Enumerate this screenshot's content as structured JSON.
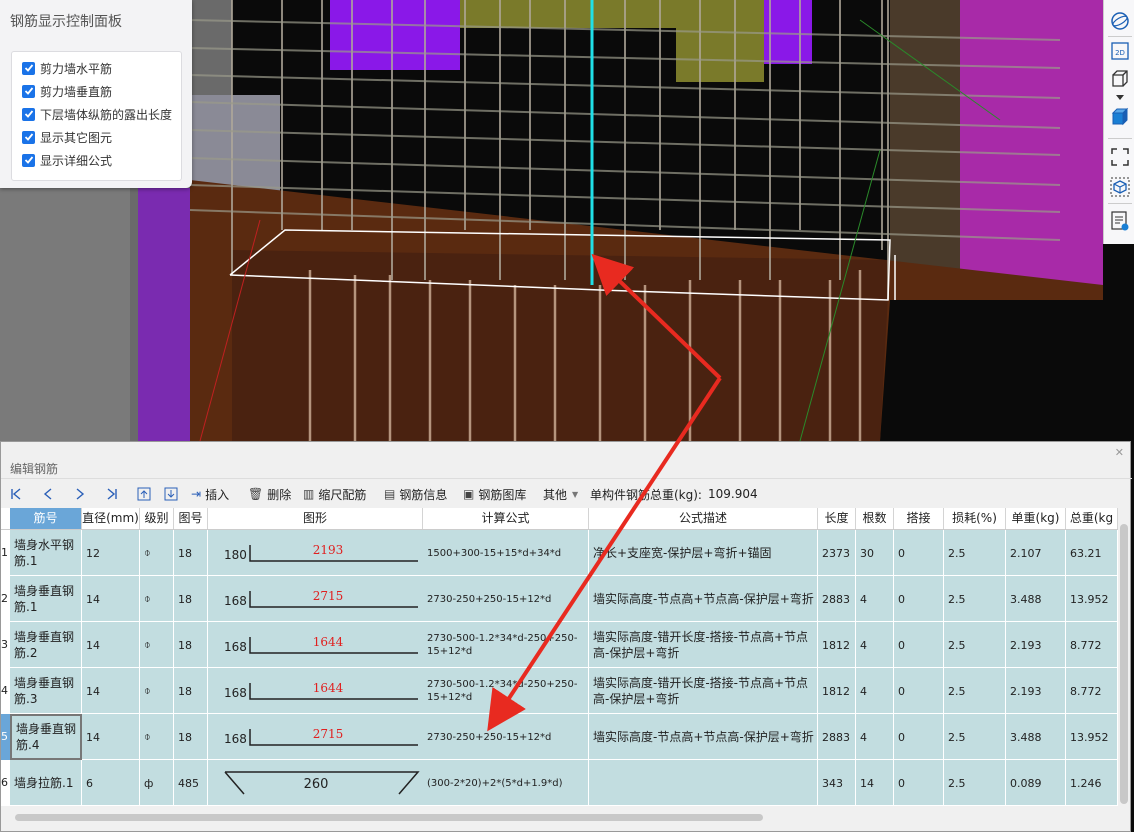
{
  "control_panel": {
    "title": "钢筋显示控制面板",
    "options": [
      {
        "label": "剪力墙水平筋",
        "checked": true
      },
      {
        "label": "剪力墙垂直筋",
        "checked": true
      },
      {
        "label": "下层墙体纵筋的露出长度",
        "checked": true
      },
      {
        "label": "显示其它图元",
        "checked": true
      },
      {
        "label": "显示详细公式",
        "checked": true
      }
    ]
  },
  "right_toolbar": {
    "icons": [
      "orbit-icon",
      "2d-view-icon",
      "cube-view-icon",
      "dropdown-arrow-icon",
      "solid-cube-icon",
      "fullscreen-icon",
      "component-box-icon",
      "list-view-icon"
    ],
    "labels": {
      "2d": "2D"
    }
  },
  "editor": {
    "title": "编辑钢筋",
    "toolbar": {
      "insert": "插入",
      "delete": "删除",
      "scale": "缩尺配筋",
      "info": "钢筋信息",
      "library": "钢筋图库",
      "other": "其他",
      "total_label": "单构件钢筋总重(kg):",
      "total_value": "109.904"
    },
    "columns": [
      "筋号",
      "直径(mm)",
      "级别",
      "图号",
      "图形",
      "计算公式",
      "公式描述",
      "长度",
      "根数",
      "搭接",
      "损耗(%)",
      "单重(kg)",
      "总重(kg"
    ],
    "rows": [
      {
        "no": "1",
        "name": "墙身水平钢筋.1",
        "dia": "12",
        "grade": "⌽",
        "fig": "18",
        "left": "180",
        "mid": "2193",
        "formula": "1500+300-15+15*d+34*d",
        "desc": "净长+支座宽-保护层+弯折+锚固",
        "len": "2373",
        "count": "30",
        "lap": "0",
        "loss": "2.5",
        "unit": "2.107",
        "total": "63.21"
      },
      {
        "no": "2",
        "name": "墙身垂直钢筋.1",
        "dia": "14",
        "grade": "⌽",
        "fig": "18",
        "left": "168",
        "mid": "2715",
        "formula": "2730-250+250-15+12*d",
        "desc": "墙实际高度-节点高+节点高-保护层+弯折",
        "len": "2883",
        "count": "4",
        "lap": "0",
        "loss": "2.5",
        "unit": "3.488",
        "total": "13.952"
      },
      {
        "no": "3",
        "name": "墙身垂直钢筋.2",
        "dia": "14",
        "grade": "⌽",
        "fig": "18",
        "left": "168",
        "mid": "1644",
        "formula": "2730-500-1.2*34*d-250+250-15+12*d",
        "desc": "墙实际高度-错开长度-搭接-节点高+节点高-保护层+弯折",
        "len": "1812",
        "count": "4",
        "lap": "0",
        "loss": "2.5",
        "unit": "2.193",
        "total": "8.772"
      },
      {
        "no": "4",
        "name": "墙身垂直钢筋.3",
        "dia": "14",
        "grade": "⌽",
        "fig": "18",
        "left": "168",
        "mid": "1644",
        "formula": "2730-500-1.2*34*d-250+250-15+12*d",
        "desc": "墙实际高度-错开长度-搭接-节点高+节点高-保护层+弯折",
        "len": "1812",
        "count": "4",
        "lap": "0",
        "loss": "2.5",
        "unit": "2.193",
        "total": "8.772"
      },
      {
        "no": "5",
        "name": "墙身垂直钢筋.4",
        "dia": "14",
        "grade": "⌽",
        "fig": "18",
        "left": "168",
        "mid": "2715",
        "formula": "2730-250+250-15+12*d",
        "desc": "墙实际高度-节点高+节点高-保护层+弯折",
        "len": "2883",
        "count": "4",
        "lap": "0",
        "loss": "2.5",
        "unit": "3.488",
        "total": "13.952"
      },
      {
        "no": "6",
        "name": "墙身拉筋.1",
        "dia": "6",
        "grade": "ф",
        "fig": "485",
        "left": "",
        "mid": "260",
        "formula": "(300-2*20)+2*(5*d+1.9*d)",
        "desc": "",
        "len": "343",
        "count": "14",
        "lap": "0",
        "loss": "2.5",
        "unit": "0.089",
        "total": "1.246"
      }
    ]
  }
}
